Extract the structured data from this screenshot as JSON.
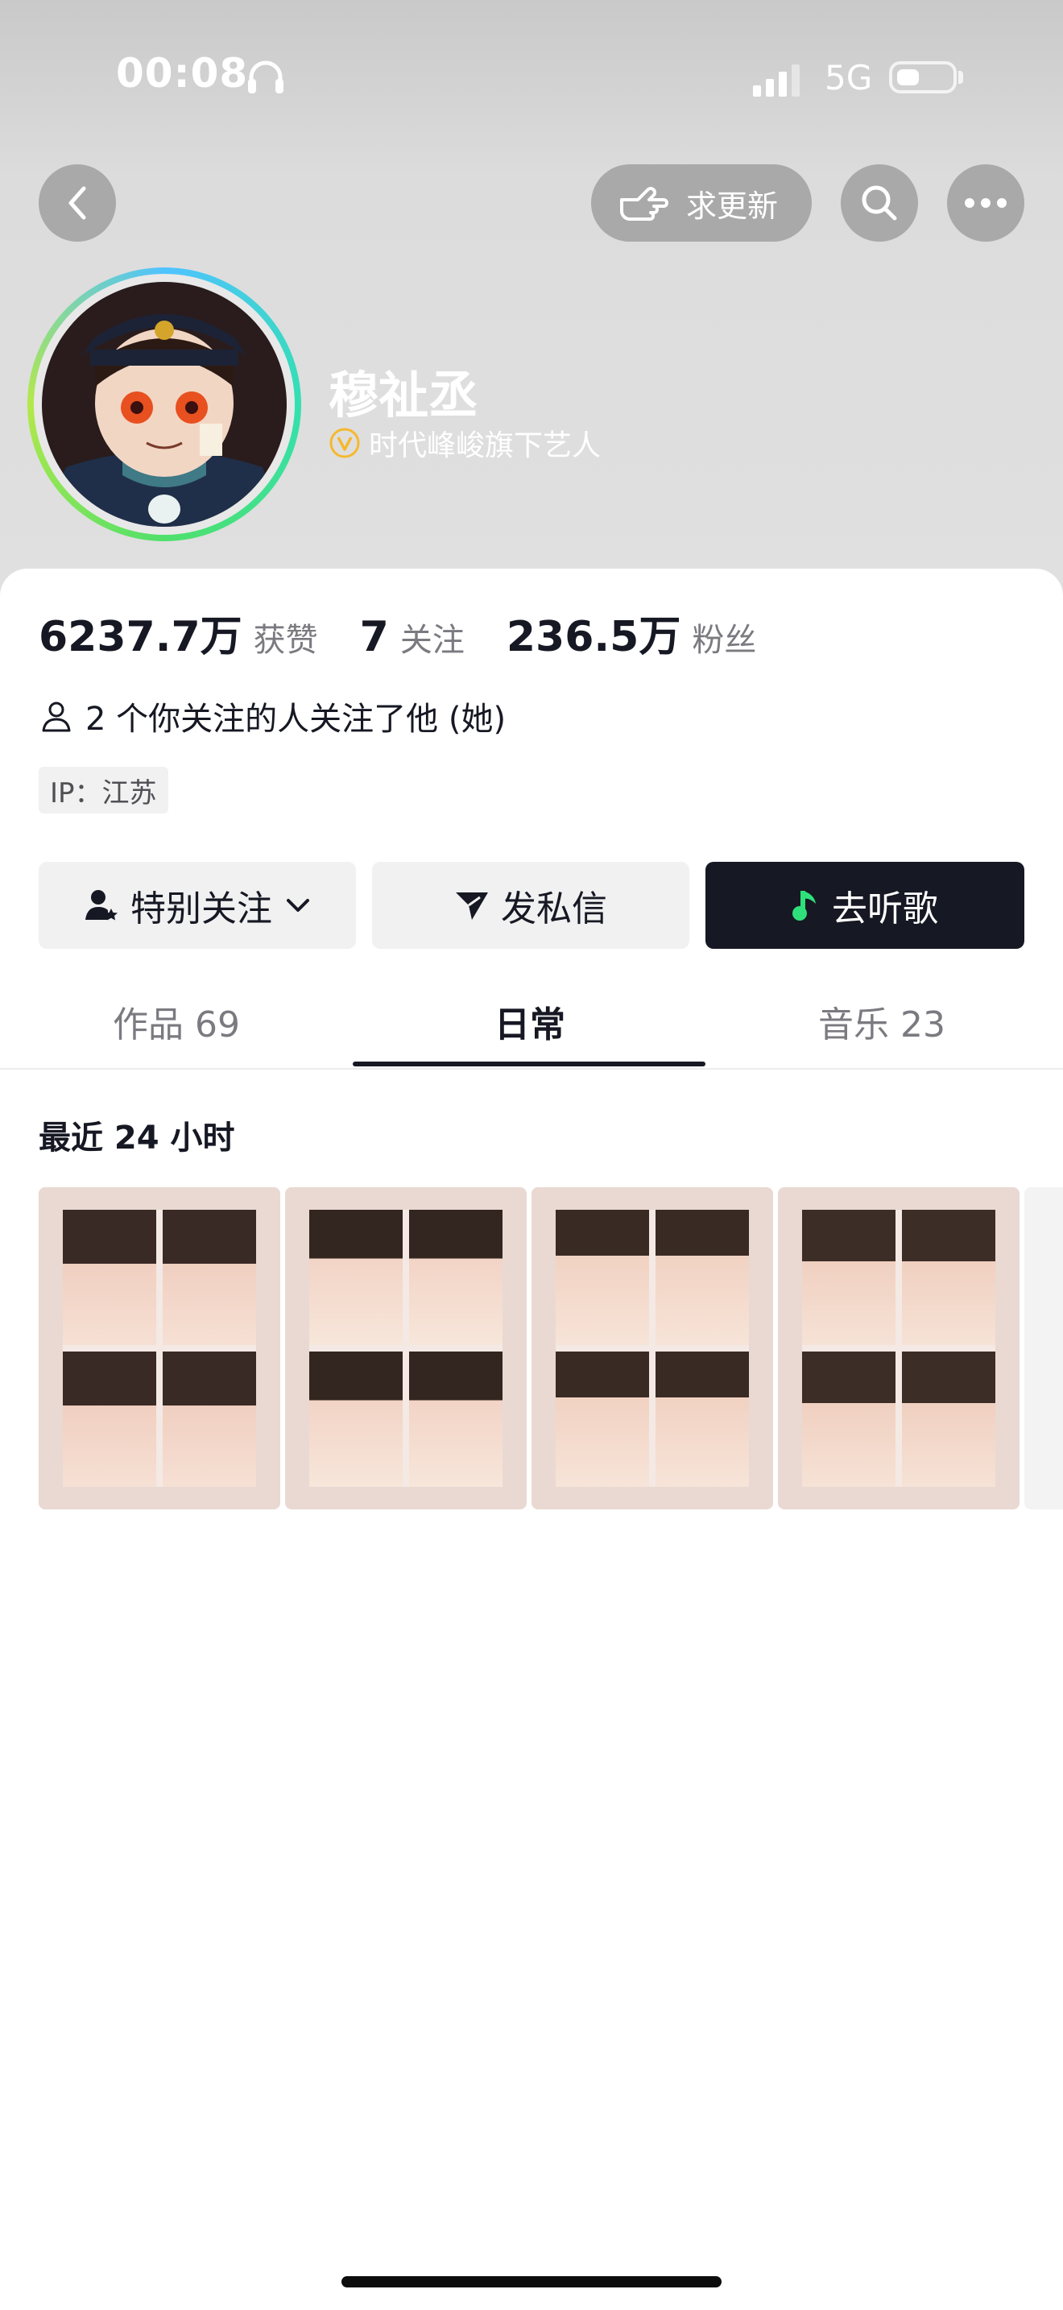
{
  "status_bar": {
    "time": "00:08",
    "network": "5G",
    "battery_percent": 40
  },
  "top_bar": {
    "back_icon": "chevron-left-icon",
    "request_update_label": "求更新",
    "request_update_icon": "pointing-hand-icon",
    "search_icon": "search-icon",
    "more_icon": "more-dots-icon"
  },
  "profile": {
    "name": "穆祉丞",
    "verification": "时代峰峻旗下艺人",
    "verification_icon": "verified-v-icon"
  },
  "stats": [
    {
      "value": "6237.7万",
      "label": "获赞"
    },
    {
      "value": "7",
      "label": "关注"
    },
    {
      "value": "236.5万",
      "label": "粉丝"
    }
  ],
  "mutual_follow": "2 个你关注的人关注了他 (她)",
  "ip_location": "IP：江苏",
  "actions": {
    "special_follow": "特别关注",
    "message": "发私信",
    "listen": "去听歌"
  },
  "tabs": [
    {
      "label": "作品 69",
      "active": false
    },
    {
      "label": "日常",
      "active": true
    },
    {
      "label": "音乐 23",
      "active": false
    }
  ],
  "recent_section": {
    "title": "最近 24 小时"
  },
  "colors": {
    "primary_text": "#161823",
    "secondary_text": "#7a7a80",
    "dark_button": "#161823",
    "verify_gold": "#f5b82e",
    "music_green": "#2fe07a"
  }
}
